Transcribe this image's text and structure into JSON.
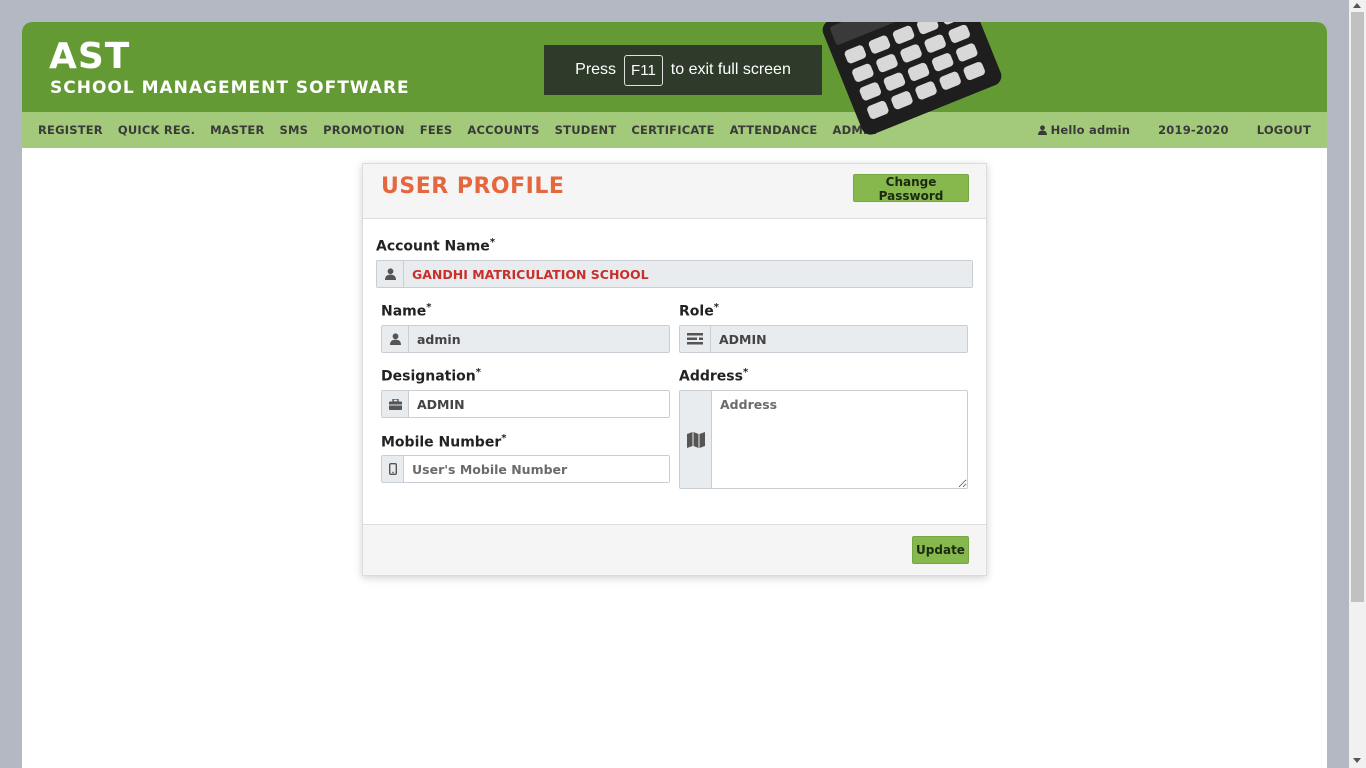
{
  "brand": {
    "title": "AST",
    "subtitle": "SCHOOL MANAGEMENT SOFTWARE"
  },
  "fullscreen_notice": {
    "press": "Press",
    "key": "F11",
    "suffix": "to exit full screen"
  },
  "nav": {
    "items": [
      {
        "label": "REGISTER"
      },
      {
        "label": "QUICK REG."
      },
      {
        "label": "MASTER"
      },
      {
        "label": "SMS"
      },
      {
        "label": "PROMOTION"
      },
      {
        "label": "FEES"
      },
      {
        "label": "ACCOUNTS"
      },
      {
        "label": "STUDENT"
      },
      {
        "label": "CERTIFICATE"
      },
      {
        "label": "ATTENDANCE"
      },
      {
        "label": "ADMIN"
      }
    ],
    "user_greeting": "Hello admin",
    "session": "2019-2020",
    "logout": "LOGOUT"
  },
  "profile": {
    "title": "USER PROFILE",
    "change_password": "Change Password",
    "account_name": {
      "label": "Account Name",
      "required": "*",
      "value": "GANDHI MATRICULATION SCHOOL"
    },
    "name": {
      "label": "Name",
      "required": "*",
      "value": "admin"
    },
    "role": {
      "label": "Role",
      "required": "*",
      "value": "ADMIN"
    },
    "designation": {
      "label": "Designation",
      "required": "*",
      "value": "ADMIN"
    },
    "address": {
      "label": "Address",
      "required": "*",
      "value": "",
      "placeholder": "Address"
    },
    "mobile": {
      "label": "Mobile Number",
      "required": "*",
      "value": "",
      "placeholder": "User's Mobile Number"
    },
    "update": "Update"
  },
  "colors": {
    "header": "#649a34",
    "navbar": "#a3c97a",
    "accent_title": "#e4673e",
    "button": "#86b84e",
    "account_value": "#c9302c"
  },
  "icons": [
    "user-icon",
    "list-icon",
    "briefcase-icon",
    "map-icon",
    "mobile-icon",
    "calculator-icon"
  ]
}
